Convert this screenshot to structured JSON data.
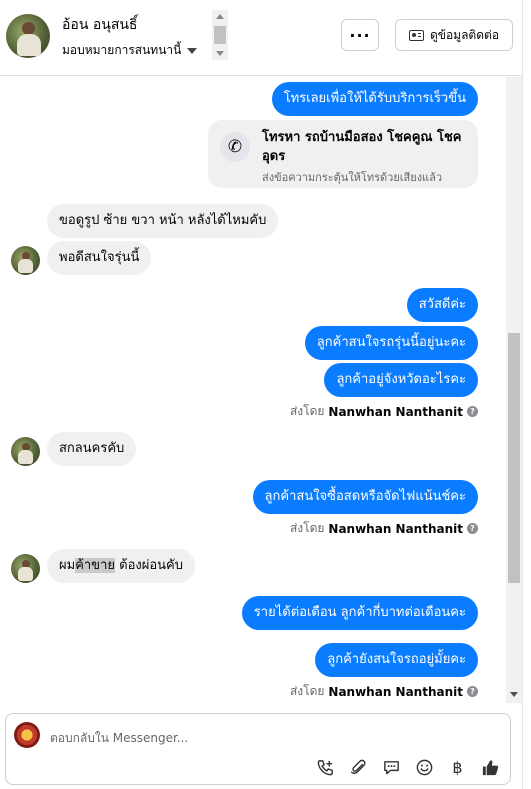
{
  "header": {
    "name": "อ้อน อนุสนธิ์",
    "assign_label": "มอบหมายการสนทนานี้",
    "more_label": "···",
    "contact_label": "ดูข้อมูลติดต่อ"
  },
  "messages": {
    "m1": "โทรเลยเพื่อให้ได้รับบริการเร็วขึ้น",
    "call_title": "โทรหา รถบ้านมือสอง โชคคูณ โชคอุดร",
    "call_sub": "ส่งข้อความกระตุ้นให้โทรด้วยเสียงแล้ว",
    "m2": "ขอดูรูป ซ้าย ขวา หน้า หลังได้ไหมคับ",
    "m3": "พอดีสนใจรุ่นนี้",
    "m4": "สวัสดีค่ะ",
    "m5": "ลูกค้าสนใจรถรุ่นนี้อยู่นะคะ",
    "m6": "ลูกค้าอยู่จังหวัดอะไรคะ",
    "sent_by_prefix": "ส่งโดย",
    "sent_by_name": "Nanwhan Nanthanit",
    "m7": "สกลนครคับ",
    "m8": "ลูกค้าสนใจซื้อสดหรือจัดไฟแน้นช์คะ",
    "m9_a": "ผม",
    "m9_hl": "ค้าขาย",
    "m9_b": " ต้องผ่อนคับ",
    "m10": "รายได้ต่อเดือน ลูกค้ากี่บาทต่อเดือนคะ",
    "m11": "ลูกค้ายังสนใจรถอยู่มั้ยคะ"
  },
  "composer": {
    "placeholder": "ตอบกลับใน Messenger..."
  },
  "colors": {
    "outgoing": "#0a7cff",
    "incoming": "#f0f0f0"
  }
}
